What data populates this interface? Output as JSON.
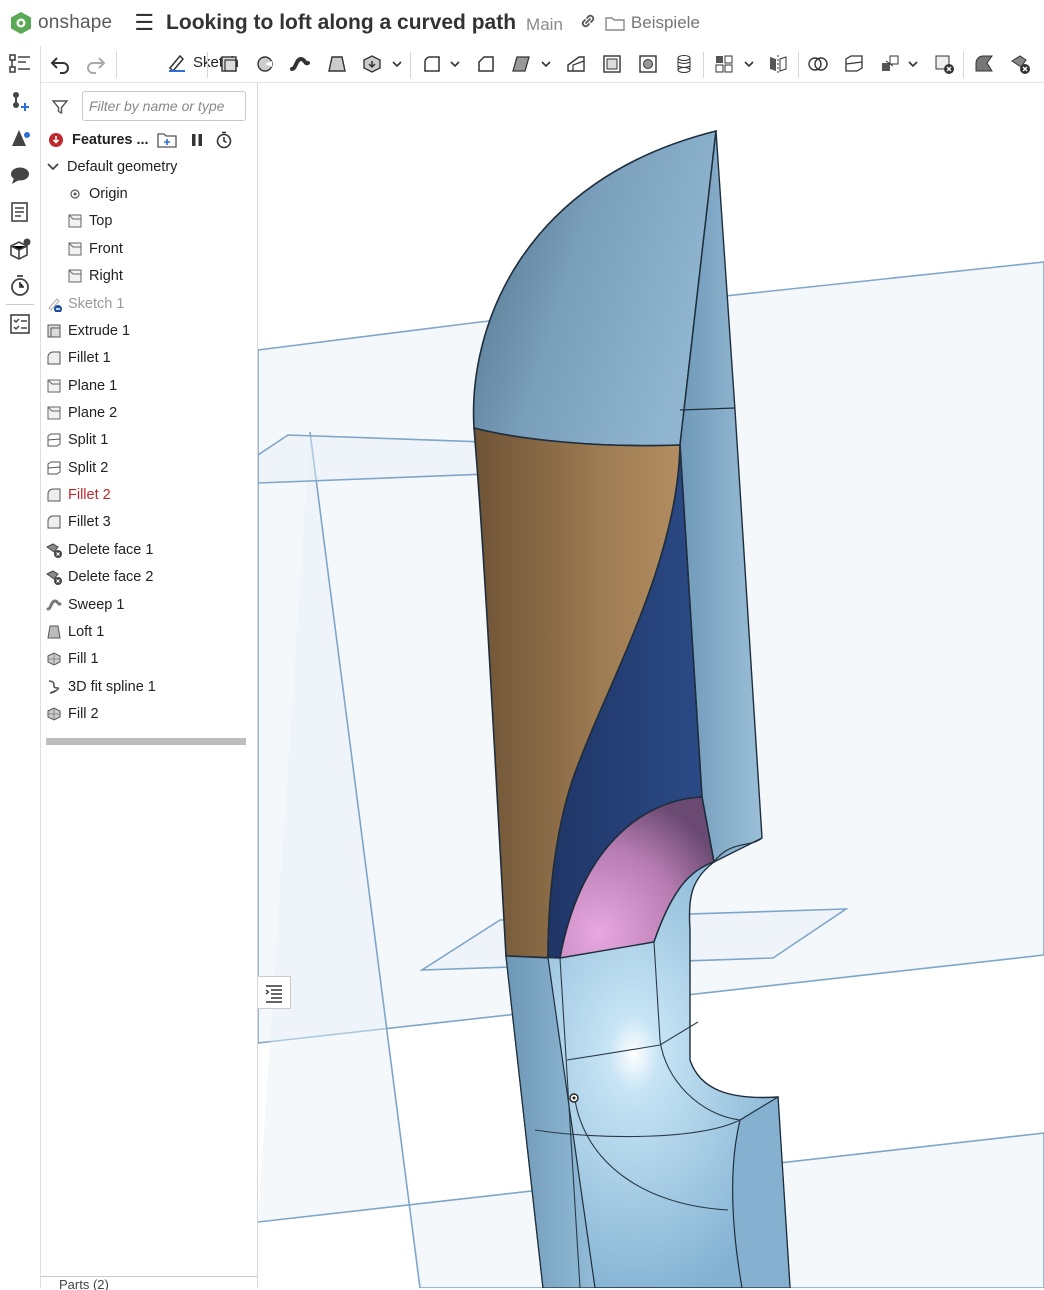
{
  "app": {
    "name": "onshape"
  },
  "document": {
    "title": "Looking to loft along a curved path",
    "branch": "Main",
    "folder": "Beispiele"
  },
  "toolbar": {
    "sketch_label": "Sketch"
  },
  "filter": {
    "placeholder": "Filter by name or type",
    "value": ""
  },
  "features": {
    "header": "Features ...",
    "default_geometry": "Default geometry",
    "planes": [
      "Origin",
      "Top",
      "Front",
      "Right"
    ],
    "items": [
      {
        "label": "Sketch 1",
        "state": "suppressed"
      },
      {
        "label": "Extrude 1",
        "state": "normal"
      },
      {
        "label": "Fillet 1",
        "state": "normal"
      },
      {
        "label": "Plane 1",
        "state": "normal"
      },
      {
        "label": "Plane 2",
        "state": "normal"
      },
      {
        "label": "Split 1",
        "state": "normal"
      },
      {
        "label": "Split 2",
        "state": "normal"
      },
      {
        "label": "Fillet 2",
        "state": "error"
      },
      {
        "label": "Fillet 3",
        "state": "normal"
      },
      {
        "label": "Delete face 1",
        "state": "normal"
      },
      {
        "label": "Delete face 2",
        "state": "normal"
      },
      {
        "label": "Sweep 1",
        "state": "normal"
      },
      {
        "label": "Loft 1",
        "state": "normal"
      },
      {
        "label": "Fill 1",
        "state": "normal"
      },
      {
        "label": "3D fit spline 1",
        "state": "normal"
      },
      {
        "label": "Fill 2",
        "state": "normal"
      }
    ]
  },
  "parts": {
    "label": "Parts (2)"
  },
  "colors": {
    "brand": "#3a9a4a",
    "error": "#c0282d",
    "accent_blue": "#2c5aa0",
    "body_blue": "#8fb8d6"
  }
}
